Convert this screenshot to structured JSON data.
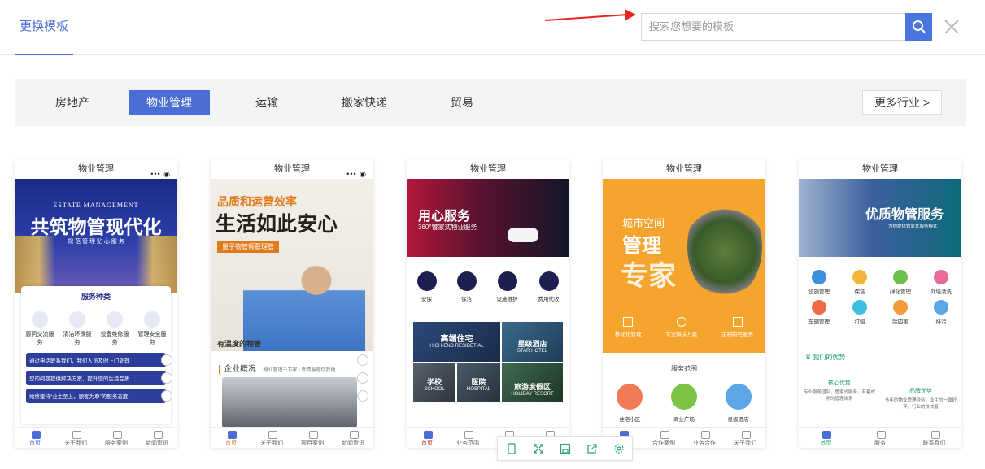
{
  "header": {
    "tab_title": "更换模板",
    "search_placeholder": "搜索您想要的模板"
  },
  "industries": [
    {
      "label": "房地产",
      "active": false
    },
    {
      "label": "物业管理",
      "active": true
    },
    {
      "label": "运输",
      "active": false
    },
    {
      "label": "搬家快递",
      "active": false
    },
    {
      "label": "贸易",
      "active": false
    }
  ],
  "more_industries": "更多行业 >",
  "templates": [
    {
      "title": "物业管理",
      "banner_en": "ESTATE MANAGEMENT",
      "banner_title": "共筑物管现代化",
      "banner_sub": "规 范 管 理 贴 心 服 务",
      "section": "服务种类",
      "services": [
        "顾问交流服务",
        "清洁环保服务",
        "设备维修服务",
        "管理安全服务"
      ],
      "notices": [
        "通过电话联系我们，我们人员及时上门处理",
        "您的问题提供解决方案，提升您的生活品质",
        "始终坚持“业主至上，顾客为尊”的服务态度"
      ],
      "tabs": [
        "首页",
        "关于我们",
        "服务案例",
        "新闻资讯"
      ]
    },
    {
      "title": "物业管理",
      "headline1": "品质和运营效率",
      "headline2": "生活如此安心",
      "ribbon": "量子物管倾慕理管",
      "caption": "有温度的物管",
      "section": "企业概况",
      "section_sub": "物业管理千万家 | 真情服务你我他",
      "tabs": [
        "首页",
        "关于我们",
        "项目案例",
        "新闻资讯"
      ]
    },
    {
      "title": "物业管理",
      "banner_title": "用心服务",
      "banner_sub": "360°管家式物业服务",
      "icons": [
        "安保",
        "保洁",
        "设施维护",
        "费用代收"
      ],
      "tiles": [
        {
          "cn": "高端住宅",
          "en": "HIGH-END RESIDETIAL"
        },
        {
          "cn": "星级酒店",
          "en": "STAR HOTEL"
        },
        {
          "cn": "学校",
          "en": "SCHOOL"
        },
        {
          "cn": "医院",
          "en": "HOSPITAL"
        },
        {
          "cn": "旅游度假区",
          "en": "HOLIDAY RESORT"
        }
      ],
      "tabs": [
        "首页",
        "业务范围",
        "",
        ""
      ]
    },
    {
      "title": "物业管理",
      "banner_lines": [
        "城市空间",
        "管理",
        "专家"
      ],
      "features": [
        "移动化管理",
        "专业解决方案",
        "定制特色服务"
      ],
      "section": "服务范围",
      "scopes": [
        "住宅小区",
        "商业广场",
        "星级酒店"
      ],
      "tabs": [
        "",
        "合作案例",
        "业务合作",
        "关于我们"
      ]
    },
    {
      "title": "物业管理",
      "banner_title": "优质物管服务",
      "banner_sub": "为你提供管家式服务模式",
      "grid": [
        "设施管理",
        "保洁",
        "绿化管理",
        "外墙清洗",
        "车辆管理",
        "打蜡",
        "除四害",
        "排污"
      ],
      "section": "我们的优势",
      "adv1_title": "核心优势",
      "adv1_text": "专业服务团队，管家式服务，有着成熟的管理体系",
      "adv2_title": "品牌优势",
      "adv2_text": "多年的物业管理经验，业主的一致好评，行业的佼佼者",
      "tabs": [
        "首页",
        "服务",
        "联系我们"
      ]
    }
  ],
  "toolbar": [
    "phone-icon",
    "fullscreen-icon",
    "save-icon",
    "share-icon",
    "settings-icon"
  ]
}
